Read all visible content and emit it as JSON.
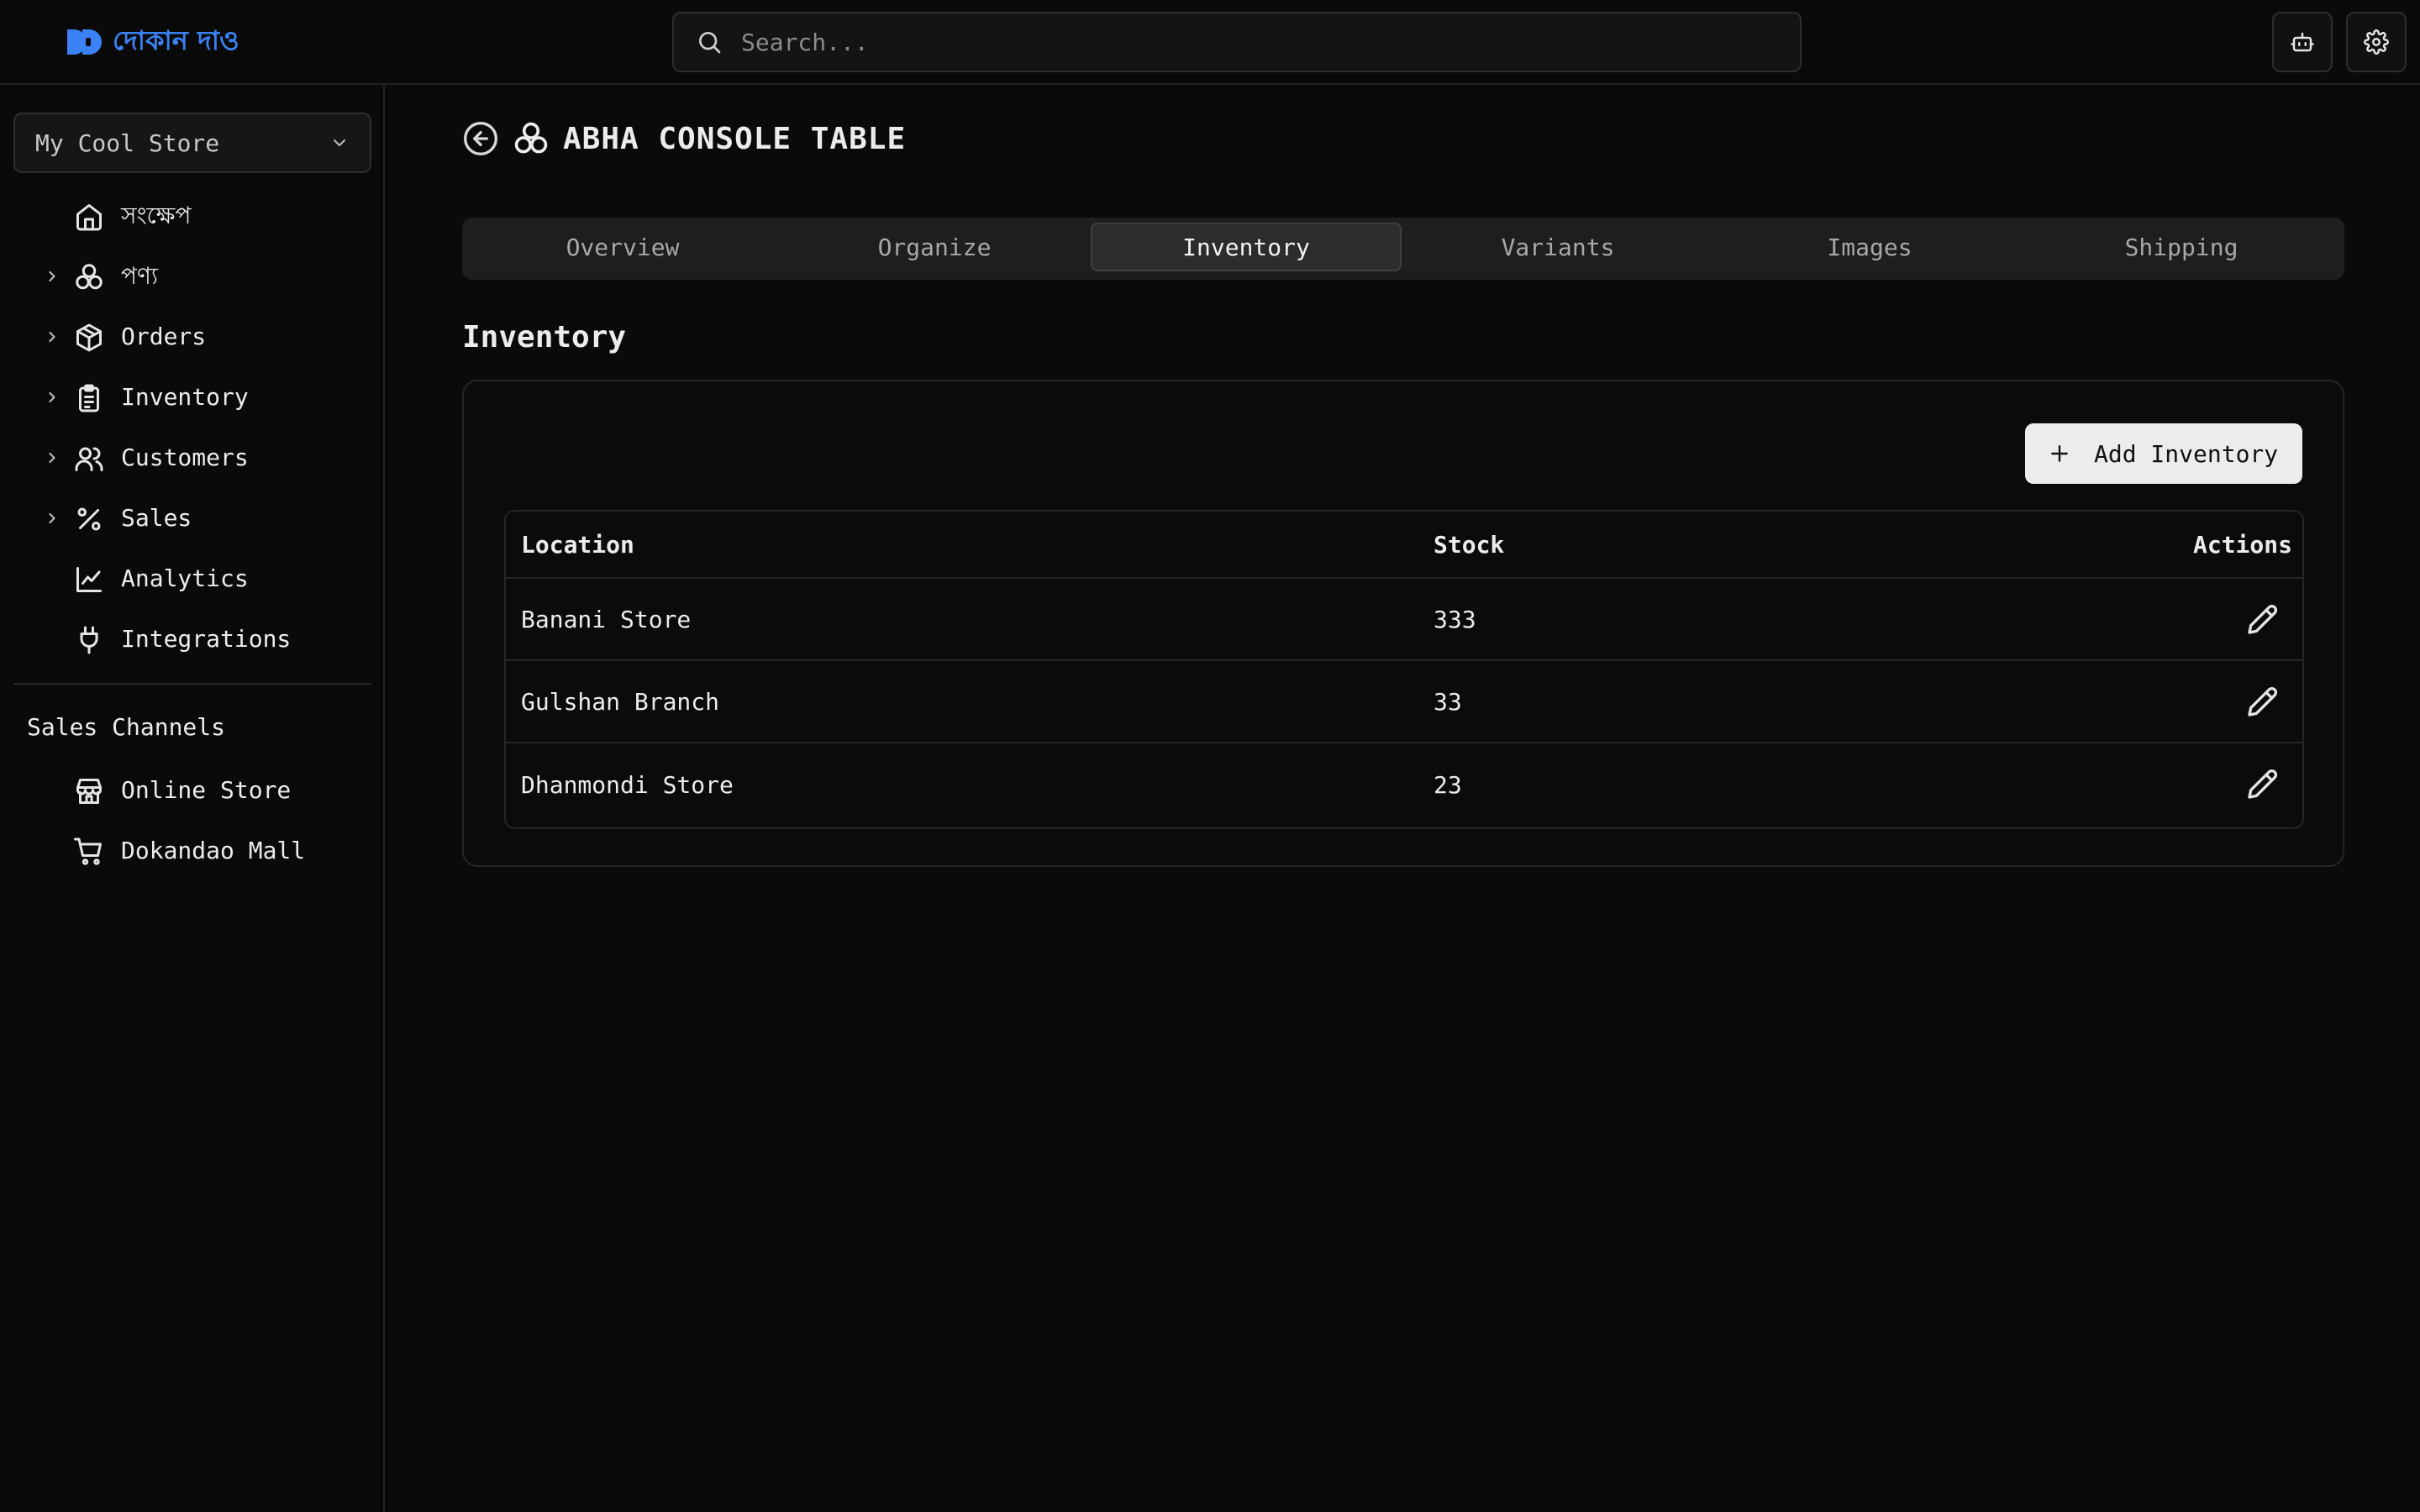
{
  "app": {
    "logo_text": "দোকান দাও",
    "search_placeholder": "Search...",
    "accent_color": "#3b82f6",
    "toolbar": [
      {
        "icon": "bot-icon"
      },
      {
        "icon": "gear-icon"
      }
    ]
  },
  "sidebar": {
    "store_selector": "My Cool Store",
    "items": [
      {
        "label": "সংক্ষেপ",
        "icon": "home-icon",
        "expandable": false
      },
      {
        "label": "পণ্য",
        "icon": "products-icon",
        "expandable": true
      },
      {
        "label": "Orders",
        "icon": "box-icon",
        "expandable": true
      },
      {
        "label": "Inventory",
        "icon": "clipboard-icon",
        "expandable": true
      },
      {
        "label": "Customers",
        "icon": "users-icon",
        "expandable": true
      },
      {
        "label": "Sales",
        "icon": "percent-icon",
        "expandable": true
      },
      {
        "label": "Analytics",
        "icon": "chart-line-icon",
        "expandable": false
      },
      {
        "label": "Integrations",
        "icon": "plug-icon",
        "expandable": false
      }
    ],
    "sales_channels_title": "Sales Channels",
    "sales_channels": [
      {
        "label": "Online Store",
        "icon": "store-icon"
      },
      {
        "label": "Dokandao Mall",
        "icon": "cart-icon"
      }
    ]
  },
  "main": {
    "product_title": "ABHA CONSOLE TABLE",
    "tabs": [
      {
        "label": "Overview",
        "active": false
      },
      {
        "label": "Organize",
        "active": false
      },
      {
        "label": "Inventory",
        "active": true
      },
      {
        "label": "Variants",
        "active": false
      },
      {
        "label": "Images",
        "active": false
      },
      {
        "label": "Shipping",
        "active": false
      }
    ],
    "section_title": "Inventory",
    "add_button": "Add Inventory",
    "table": {
      "columns": [
        "Location",
        "Stock",
        "Actions"
      ],
      "rows": [
        {
          "location": "Banani Store",
          "stock": "333"
        },
        {
          "location": "Gulshan Branch",
          "stock": "33"
        },
        {
          "location": "Dhanmondi Store",
          "stock": "23"
        }
      ]
    }
  }
}
